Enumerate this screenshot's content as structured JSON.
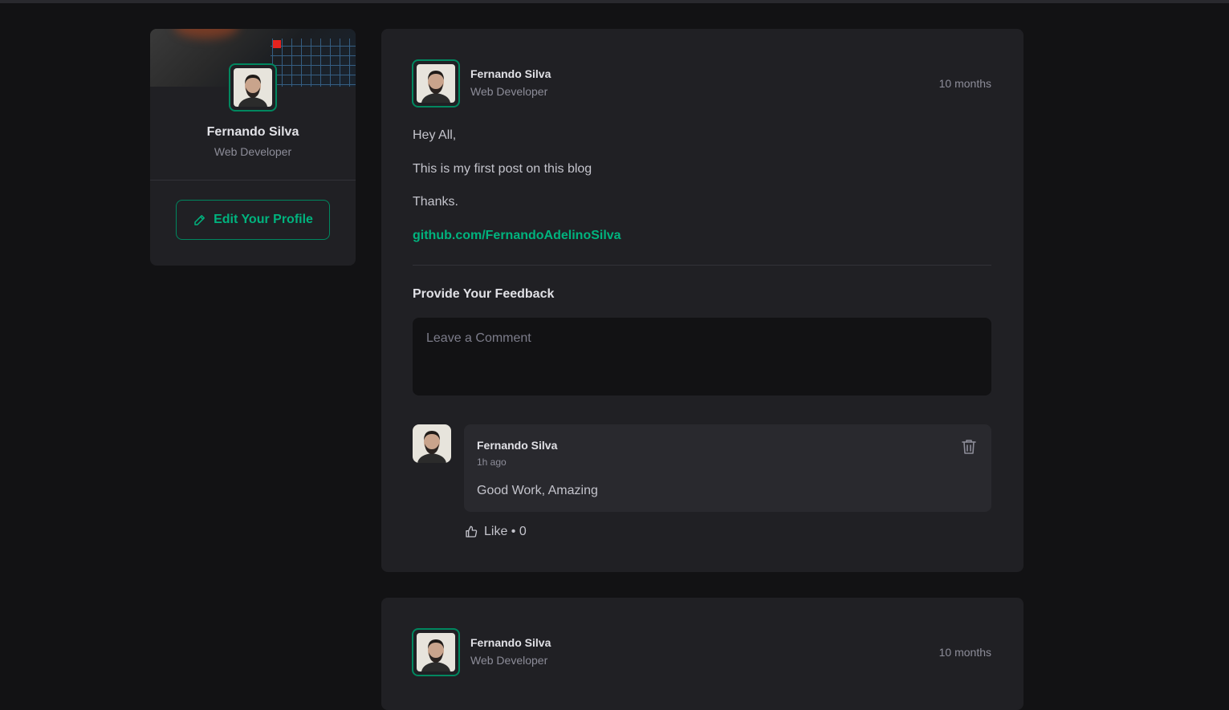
{
  "profile": {
    "name": "Fernando Silva",
    "role": "Web Developer",
    "edit_label": "Edit Your Profile"
  },
  "posts": [
    {
      "author": {
        "name": "Fernando Silva",
        "role": "Web Developer"
      },
      "published": "10 months",
      "content": {
        "greeting": "Hey All,",
        "body": "This is my first post on this blog",
        "closing": "Thanks.",
        "link": "github.com/FernandoAdelinoSilva"
      },
      "feedback_title": "Provide Your Feedback",
      "comment_placeholder": "Leave a Comment",
      "comments": [
        {
          "author": "Fernando Silva",
          "time": "1h ago",
          "text": "Good Work, Amazing",
          "like_label": "Like • 0"
        }
      ]
    },
    {
      "author": {
        "name": "Fernando Silva",
        "role": "Web Developer"
      },
      "published": "10 months"
    }
  ],
  "colors": {
    "background": "#121214",
    "card": "#202024",
    "comment_card": "#29292e",
    "accent": "#00875f",
    "accent_light": "#00b37e"
  },
  "icons": {
    "edit": "pencil-icon",
    "delete": "trash-icon",
    "like": "thumbs-up-icon"
  }
}
